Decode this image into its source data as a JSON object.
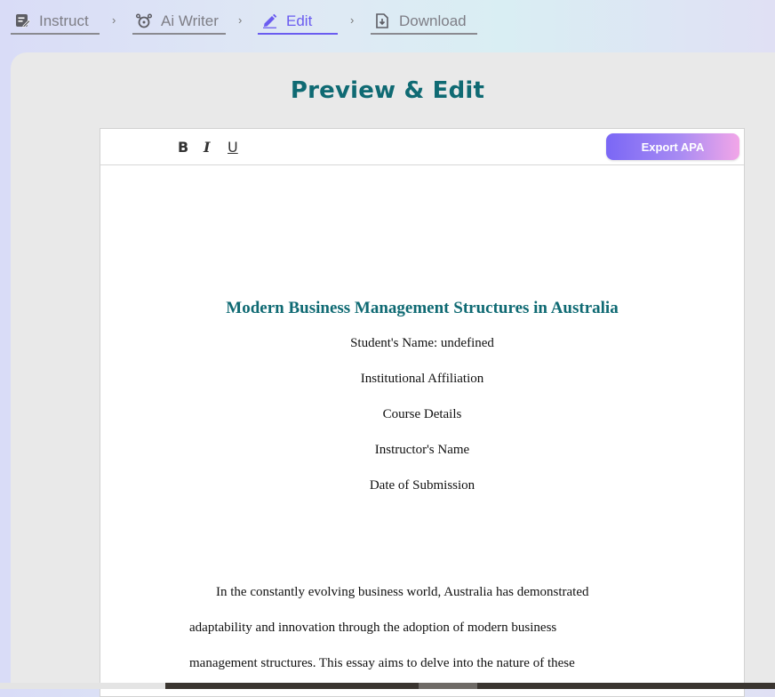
{
  "steps": [
    {
      "label": "Instruct",
      "icon": "edit-note-icon"
    },
    {
      "label": "Ai Writer",
      "icon": "pen-tool-icon"
    },
    {
      "label": "Edit",
      "icon": "pencil-icon",
      "active": true
    },
    {
      "label": "Download",
      "icon": "download-file-icon"
    }
  ],
  "separator": "›",
  "page_title": "Preview & Edit",
  "toolbar": {
    "bold": "B",
    "italic": "I",
    "underline": "U",
    "export_label": "Export APA"
  },
  "document": {
    "title": "Modern Business Management Structures in Australia",
    "cover_lines": [
      "Student's Name: undefined",
      "Institutional Affiliation",
      "Course Details",
      "Instructor's Name",
      "Date of Submission"
    ],
    "body_lines": [
      "In the constantly evolving business world, Australia has demonstrated",
      "adaptability and innovation through the adoption of modern business",
      "management structures. This essay aims to delve into the nature of these"
    ]
  },
  "colors": {
    "accent": "#6a5cf0",
    "title_teal": "#0f6a73"
  }
}
